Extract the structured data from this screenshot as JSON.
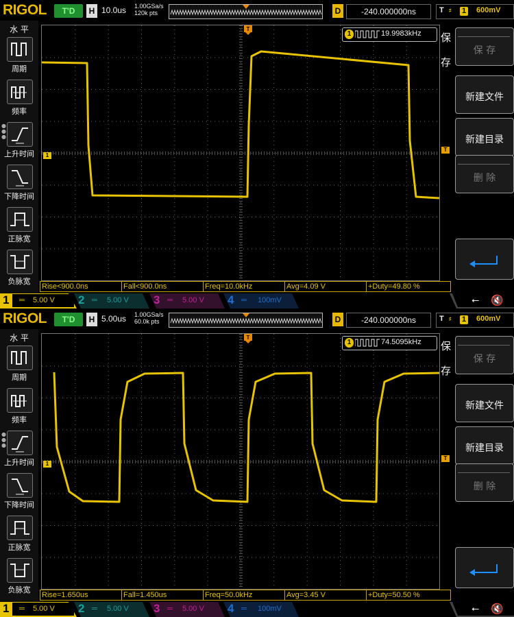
{
  "scopes": [
    {
      "brand": "RIGOL",
      "run_status": "T'D",
      "timebase_label": "H",
      "timebase": "10.0us",
      "sample_rate": "1.00GSa/s",
      "memory_depth": "120k pts",
      "delay_label": "D",
      "delay": "-240.000000ns",
      "trigger_label": "T",
      "trigger_source": "1",
      "trigger_level": "600mV",
      "freq_counter": "19.9983kHz",
      "left_menu_header": "水 平",
      "left_menu": [
        "周期",
        "频率",
        "上升时间",
        "下降时间",
        "正脉宽",
        "负脉宽"
      ],
      "right_menu_title": [
        "保",
        "存"
      ],
      "right_buttons": [
        "保 存",
        "新建文件",
        "新建目录",
        "删 除"
      ],
      "measurements": [
        "Rise<900.0ns",
        "Fall<900.0ns",
        "Freq=10.0kHz",
        "Avg=4.09 V",
        "+Duty=49.80 %"
      ],
      "channels": [
        {
          "num": "1",
          "scale": "5.00 V"
        },
        {
          "num": "2",
          "scale": "5.00 V"
        },
        {
          "num": "3",
          "scale": "5.00 V"
        },
        {
          "num": "4",
          "scale": "100mV"
        }
      ]
    },
    {
      "brand": "RIGOL",
      "run_status": "T'D",
      "timebase_label": "H",
      "timebase": "5.00us",
      "sample_rate": "1.00GSa/s",
      "memory_depth": "60.0k pts",
      "delay_label": "D",
      "delay": "-240.000000ns",
      "trigger_label": "T",
      "trigger_source": "1",
      "trigger_level": "600mV",
      "freq_counter": "74.5095kHz",
      "left_menu_header": "水 平",
      "left_menu": [
        "周期",
        "频率",
        "上升时间",
        "下降时间",
        "正脉宽",
        "负脉宽"
      ],
      "right_menu_title": [
        "保",
        "存"
      ],
      "right_buttons": [
        "保 存",
        "新建文件",
        "新建目录",
        "删 除"
      ],
      "measurements": [
        "Rise=1.650us",
        "Fall=1.450us",
        "Freq=50.0kHz",
        "Avg=3.45 V",
        "+Duty=50.50 %"
      ],
      "channels": [
        {
          "num": "1",
          "scale": "5.00 V"
        },
        {
          "num": "2",
          "scale": "5.00 V"
        },
        {
          "num": "3",
          "scale": "5.00 V"
        },
        {
          "num": "4",
          "scale": "100mV"
        }
      ]
    }
  ],
  "colors": {
    "ch1": "#e8c400",
    "ch2": "#1e9fa0",
    "ch3": "#c4209a",
    "ch4": "#1d6fcf",
    "accent": "#e8b800"
  }
}
